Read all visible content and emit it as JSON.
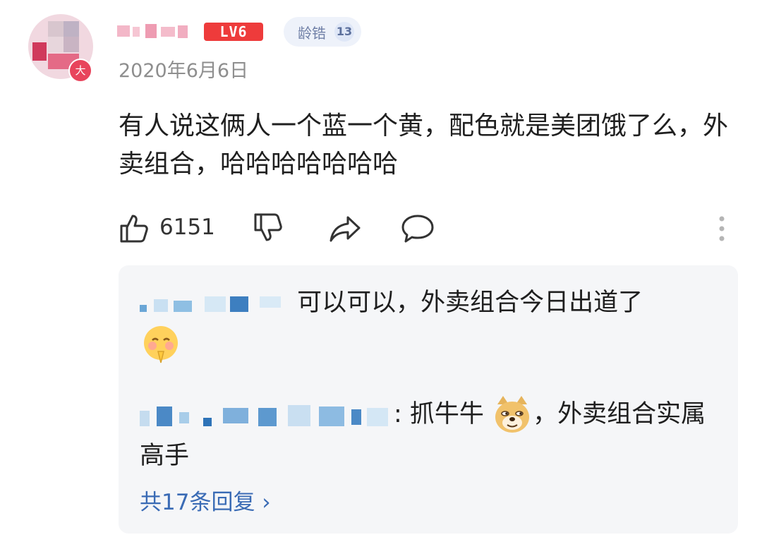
{
  "comment": {
    "level": "LV6",
    "medal": {
      "label": "龄锆",
      "count": "13"
    },
    "vip_badge": "大",
    "date": "2020年6月6日",
    "text": "有人说这俩人一个蓝一个黄，配色就是美团饿了么，外卖组合，哈哈哈哈哈哈哈",
    "likes": "6151"
  },
  "replies": [
    {
      "text": "可以可以，外卖组合今日出道了",
      "emoji": "joy-pray-emoji"
    },
    {
      "prefix": ": 抓牛牛",
      "emoji": "doge-emoji",
      "suffix": "，外卖组合实属高手"
    }
  ],
  "view_more": "共17条回复 ›",
  "icons": [
    "thumbs-up-icon",
    "thumbs-down-icon",
    "share-icon",
    "comment-icon",
    "more-icon"
  ],
  "colors": {
    "level_red": "#ee3b3b",
    "link_blue": "#3a6bb5",
    "reply_bg": "#f5f6f8"
  }
}
